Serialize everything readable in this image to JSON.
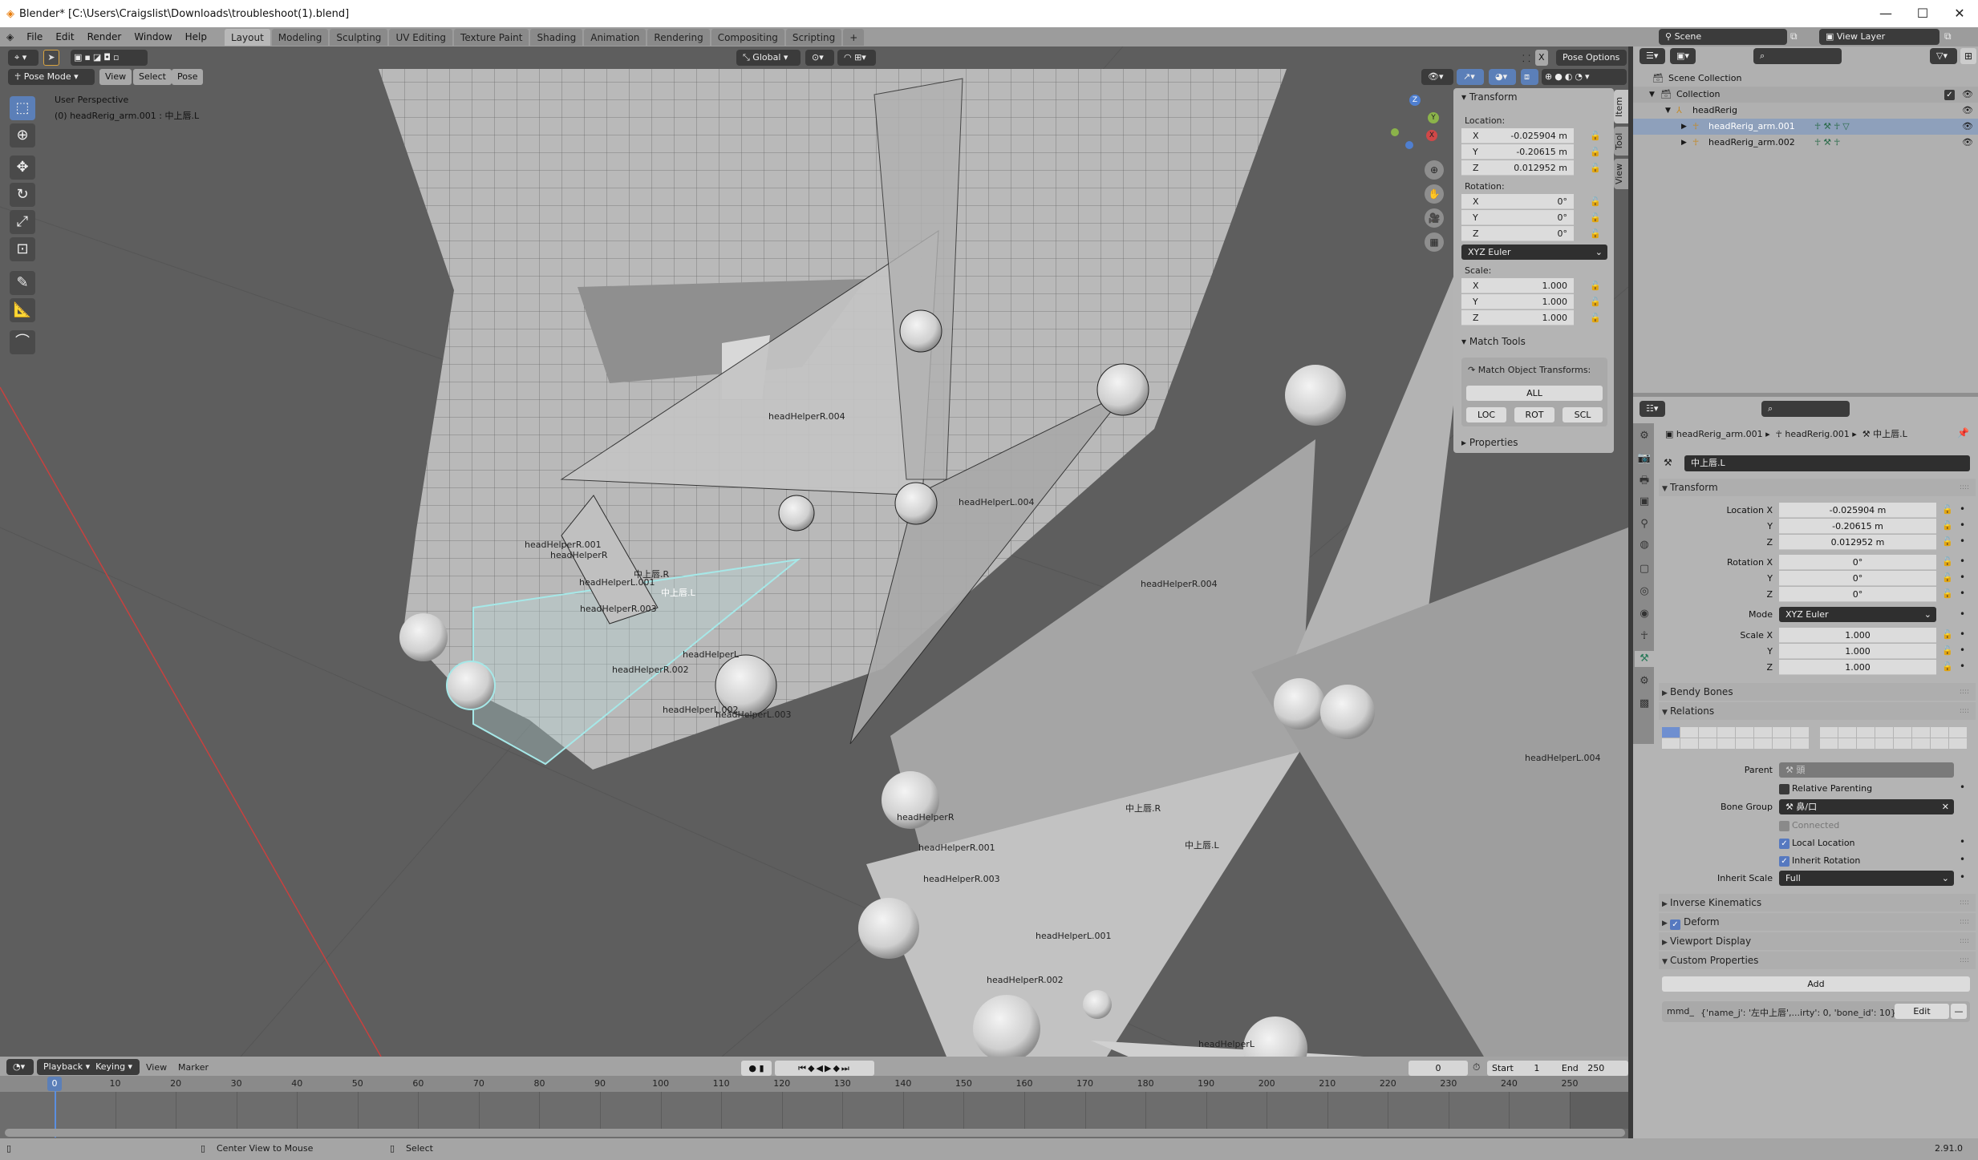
{
  "window": {
    "title": "Blender* [C:\\Users\\Craigslist\\Downloads\\troubleshoot(1).blend]",
    "minimize": "—",
    "maximize": "☐",
    "close": "✕"
  },
  "menu": {
    "items": [
      "File",
      "Edit",
      "Render",
      "Window",
      "Help"
    ]
  },
  "workspaces": {
    "tabs": [
      "Layout",
      "Modeling",
      "Sculpting",
      "UV Editing",
      "Texture Paint",
      "Shading",
      "Animation",
      "Rendering",
      "Compositing",
      "Scripting"
    ],
    "active": "Layout",
    "add": "+"
  },
  "viewport": {
    "mode": "Pose Mode",
    "menus": [
      "View",
      "Select",
      "Pose"
    ],
    "orientation": "Global",
    "pose_options": "Pose Options",
    "mirror_x": "X",
    "perspective": "User Perspective",
    "active_info": "(0) headRerig_arm.001 : 中上唇.L",
    "gizmo": {
      "x": "X",
      "y": "Y",
      "z": "Z"
    },
    "bone_labels": [
      {
        "text": "headHelperR.004",
        "selected": false
      },
      {
        "text": "headHelperL.004",
        "selected": false
      },
      {
        "text": "headHelperR.004",
        "selected": false
      },
      {
        "text": "headHelperL.004",
        "selected": false
      },
      {
        "text": "headHelperR.001",
        "selected": false
      },
      {
        "text": "headHelperR",
        "selected": false
      },
      {
        "text": "中上唇.R",
        "selected": false
      },
      {
        "text": "headHelperL.001",
        "selected": false
      },
      {
        "text": "中上唇.L",
        "selected": true
      },
      {
        "text": "headHelperR.003",
        "selected": false
      },
      {
        "text": "headHelperL",
        "selected": false
      },
      {
        "text": "headHelperR.002",
        "selected": false
      },
      {
        "text": "headHelperL.002",
        "selected": false
      },
      {
        "text": "headHelperL.003",
        "selected": false
      },
      {
        "text": "headHelperR",
        "selected": false
      },
      {
        "text": "中上唇.R",
        "selected": false
      },
      {
        "text": "headHelperR.001",
        "selected": false
      },
      {
        "text": "中上唇.L",
        "selected": false
      },
      {
        "text": "headHelperR.003",
        "selected": false
      },
      {
        "text": "headHelperL.001",
        "selected": false
      },
      {
        "text": "headHelperR.002",
        "selected": false
      },
      {
        "text": "headHelperL",
        "selected": false
      }
    ],
    "colors": {
      "x_axis": "#c8413f",
      "y_axis": "#8bb34a",
      "selection": "#a6e8e8"
    }
  },
  "npanel": {
    "tabs": [
      "Item",
      "Tool",
      "View"
    ],
    "active_tab": "Item",
    "transform_header": "Transform",
    "location_label": "Location:",
    "location": [
      {
        "axis": "X",
        "value": "-0.025904 m"
      },
      {
        "axis": "Y",
        "value": "-0.20615 m"
      },
      {
        "axis": "Z",
        "value": "0.012952 m"
      }
    ],
    "rotation_label": "Rotation:",
    "rotation": [
      {
        "axis": "X",
        "value": "0°"
      },
      {
        "axis": "Y",
        "value": "0°"
      },
      {
        "axis": "Z",
        "value": "0°"
      }
    ],
    "rotation_mode": "XYZ Euler",
    "scale_label": "Scale:",
    "scale": [
      {
        "axis": "X",
        "value": "1.000"
      },
      {
        "axis": "Y",
        "value": "1.000"
      },
      {
        "axis": "Z",
        "value": "1.000"
      }
    ],
    "match_tools_header": "Match Tools",
    "match_label": "Match Object Transforms:",
    "all": "ALL",
    "loc": "LOC",
    "rot": "ROT",
    "scl": "SCL",
    "properties_header": "Properties"
  },
  "topbar_right": {
    "scene": "Scene",
    "view_layer": "View Layer"
  },
  "outliner": {
    "rows": [
      {
        "label": "Scene Collection",
        "icon": "collection-icon"
      },
      {
        "label": "Collection",
        "icon": "collection-icon",
        "checked": true
      },
      {
        "label": "headRerig",
        "icon": "armature-icon"
      },
      {
        "label": "headRerig_arm.001",
        "icon": "armature-object-icon",
        "selected": true
      },
      {
        "label": "headRerig_arm.002",
        "icon": "armature-object-icon"
      }
    ]
  },
  "properties": {
    "breadcrumb": [
      "headRerig_arm.001",
      "headRerig.001",
      "中上唇.L"
    ],
    "bone_name": "中上唇.L",
    "transform_header": "Transform",
    "rows": [
      {
        "label": "Location X",
        "value": "-0.025904 m"
      },
      {
        "label": "Y",
        "value": "-0.20615 m"
      },
      {
        "label": "Z",
        "value": "0.012952 m"
      },
      {
        "label": "Rotation X",
        "value": "0°"
      },
      {
        "label": "Y",
        "value": "0°"
      },
      {
        "label": "Z",
        "value": "0°"
      },
      {
        "label": "Scale X",
        "value": "1.000"
      },
      {
        "label": "Y",
        "value": "1.000"
      },
      {
        "label": "Z",
        "value": "1.000"
      }
    ],
    "mode_label": "Mode",
    "mode_value": "XYZ Euler",
    "bendy_bones": "Bendy Bones",
    "relations": "Relations",
    "parent_label": "Parent",
    "parent_value": "頭",
    "relative_parenting": {
      "label": "Relative Parenting",
      "checked": false
    },
    "bone_group_label": "Bone Group",
    "bone_group_value": "鼻/口",
    "connected": {
      "label": "Connected",
      "checked": false,
      "disabled": true
    },
    "local_location": {
      "label": "Local Location",
      "checked": true
    },
    "inherit_rotation": {
      "label": "Inherit Rotation",
      "checked": true
    },
    "inherit_scale_label": "Inherit Scale",
    "inherit_scale_value": "Full",
    "inverse_kinematics": "Inverse Kinematics",
    "deform": {
      "label": "Deform",
      "checked": true
    },
    "viewport_display": "Viewport Display",
    "custom_properties": "Custom Properties",
    "add": "Add",
    "custom_prop": {
      "name": "mmd_",
      "value": "{'name_j': '左中上唇',...irty': 0, 'bone_id': 10}",
      "edit": "Edit",
      "remove": "—"
    }
  },
  "timeline": {
    "menus": [
      "Playback",
      "Keying",
      "View",
      "Marker"
    ],
    "current_frame": "0",
    "start_label": "Start",
    "start": "1",
    "end_label": "End",
    "end": "250",
    "ticks": [
      "0",
      "10",
      "20",
      "30",
      "40",
      "50",
      "60",
      "70",
      "80",
      "90",
      "100",
      "110",
      "120",
      "130",
      "140",
      "150",
      "160",
      "170",
      "180",
      "190",
      "200",
      "210",
      "220",
      "230",
      "240",
      "250"
    ]
  },
  "statusbar": {
    "center_view": "Center View to Mouse",
    "select": "Select",
    "version": "2.91.0"
  }
}
